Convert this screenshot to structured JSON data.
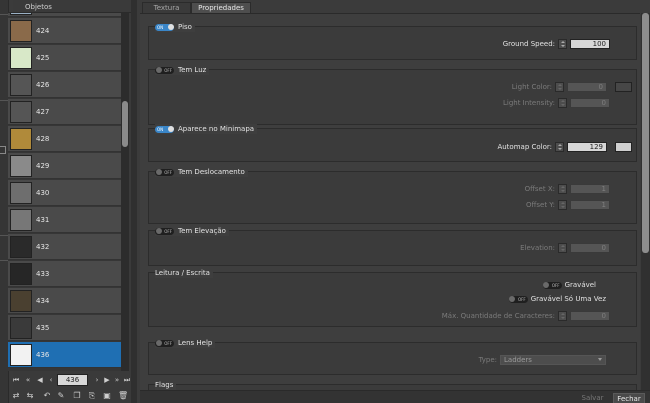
{
  "objects_panel": {
    "title": "Objetos",
    "items": [
      {
        "label": "424",
        "thumb": "#8a6a4a"
      },
      {
        "label": "425",
        "thumb": "#d8e8c8"
      },
      {
        "label": "426",
        "thumb": "#555555"
      },
      {
        "label": "427",
        "thumb": "#555555"
      },
      {
        "label": "428",
        "thumb": "#b08a3a"
      },
      {
        "label": "429",
        "thumb": "#8a8a8a"
      },
      {
        "label": "430",
        "thumb": "#6e6e6e"
      },
      {
        "label": "431",
        "thumb": "#777777"
      },
      {
        "label": "432",
        "thumb": "#2a2a2a"
      },
      {
        "label": "433",
        "thumb": "#262626"
      },
      {
        "label": "434",
        "thumb": "#4a4030"
      },
      {
        "label": "435",
        "thumb": "#3a3a3a"
      },
      {
        "label": "436",
        "thumb": "#f2f2f2"
      }
    ],
    "selected_item": "436",
    "page_field": "436"
  },
  "tabs": [
    {
      "label": "Textura",
      "active": false
    },
    {
      "label": "Propriedades",
      "active": true
    }
  ],
  "groups": {
    "piso": {
      "title": "Piso",
      "enabled": true,
      "ground_speed_label": "Ground Speed:",
      "ground_speed": "100"
    },
    "tem_luz": {
      "title": "Tem Luz",
      "enabled": false,
      "light_color_label": "Light Color:",
      "light_color": "0",
      "light_intensity_label": "Light Intensity:",
      "light_intensity": "0"
    },
    "minimapa": {
      "title": "Aparece no Minimapa",
      "enabled": true,
      "automap_color_label": "Automap Color:",
      "automap_color": "129"
    },
    "deslocamento": {
      "title": "Tem Deslocamento",
      "enabled": false,
      "offset_x_label": "Offset X:",
      "offset_x": "1",
      "offset_y_label": "Offset Y:",
      "offset_y": "1"
    },
    "elevacao": {
      "title": "Tem Elevação",
      "enabled": false,
      "elevation_label": "Elevation:",
      "elevation": "0"
    },
    "leitura": {
      "title": "Leitura / Escrita",
      "gravavel_label": "Gravável",
      "gravavel_uma_vez_label": "Gravável Só Uma Vez",
      "max_chars_label": "Máx. Quantidade de Caracteres:",
      "max_chars": "0"
    },
    "lens_help": {
      "title": "Lens Help",
      "enabled": false,
      "type_label": "Type:",
      "type_value": "Ladders"
    },
    "flags": {
      "title": "Flags"
    }
  },
  "toggle_text": {
    "on": "ON",
    "off": "OFF"
  },
  "footer": {
    "save_label": "Salvar",
    "close_label": "Fechar"
  },
  "colors": {
    "selection": "#1f6fb3",
    "toggle_on": "#3a86c8",
    "light_swatch": "#474747",
    "automap_swatch": "#cfcfcf"
  }
}
